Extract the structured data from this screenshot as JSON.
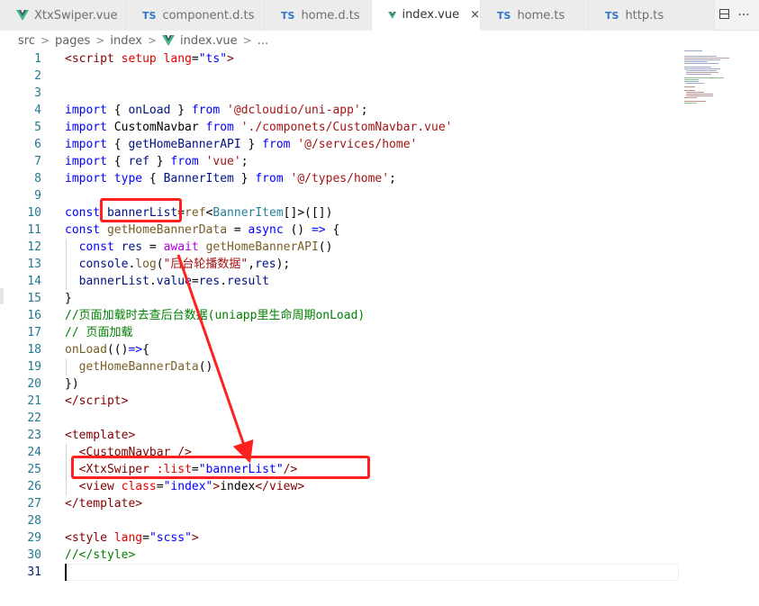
{
  "tabs": [
    {
      "label": "XtxSwiper.vue",
      "type": "vue",
      "active": false
    },
    {
      "label": "component.d.ts",
      "type": "ts",
      "active": false
    },
    {
      "label": "home.d.ts",
      "type": "ts",
      "active": false
    },
    {
      "label": "index.vue",
      "type": "vue",
      "active": true
    },
    {
      "label": "home.ts",
      "type": "ts",
      "active": false
    },
    {
      "label": "http.ts",
      "type": "ts",
      "active": false
    }
  ],
  "tab_icons": {
    "vue": "vue-icon",
    "ts": "TS",
    "close": "×"
  },
  "tab_actions": {
    "split": "split-editor-icon",
    "more": "···"
  },
  "breadcrumb": {
    "parts": [
      "src",
      "pages",
      "index",
      "index.vue",
      "..."
    ],
    "separator": ">"
  },
  "editor": {
    "line_numbers": [
      "1",
      "2",
      "3",
      "4",
      "5",
      "6",
      "7",
      "8",
      "9",
      "10",
      "11",
      "12",
      "13",
      "14",
      "15",
      "16",
      "17",
      "18",
      "19",
      "20",
      "21",
      "22",
      "23",
      "24",
      "25",
      "26",
      "27",
      "28",
      "29",
      "30",
      "31"
    ],
    "current_line": "31",
    "code": {
      "l1": [
        "<",
        "script",
        " ",
        "setup",
        " ",
        "lang",
        "=",
        "\"ts\"",
        ">"
      ],
      "l4": [
        "import",
        " { ",
        "onLoad",
        " } ",
        "from",
        " ",
        "'@dcloudio/uni-app'",
        ";"
      ],
      "l5": [
        "import",
        " CustomNavbar ",
        "from",
        " ",
        "'./componets/CustomNavbar.vue'"
      ],
      "l6": [
        "import",
        " { ",
        "getHomeBannerAPI",
        " } ",
        "from",
        " ",
        "'@/services/home'"
      ],
      "l7": [
        "import",
        " { ",
        "ref",
        " } ",
        "from",
        " ",
        "'vue'",
        ";"
      ],
      "l8": [
        "import",
        " ",
        "type",
        " { ",
        "BannerItem",
        " } ",
        "from",
        " ",
        "'@/types/home'",
        ";"
      ],
      "l10": [
        "const",
        " ",
        "bannerList",
        "=",
        "ref",
        "<",
        "BannerItem",
        "[]>([])"
      ],
      "l11": [
        "const",
        " ",
        "getHomeBannerData",
        " = ",
        "async",
        " () ",
        "=>",
        " {"
      ],
      "l12": [
        "  ",
        "const",
        " ",
        "res",
        " = ",
        "await",
        " ",
        "getHomeBannerAPI",
        "()"
      ],
      "l13": [
        "  ",
        "console",
        ".",
        "log",
        "(",
        "\"后台轮播数据\"",
        ",",
        "res",
        ");"
      ],
      "l14": [
        "  ",
        "bannerList",
        ".",
        "value",
        "=",
        "res",
        ".",
        "result"
      ],
      "l15": [
        "}"
      ],
      "l16": [
        "//页面加载时去查后台数据(uniapp里生命周期onLoad)"
      ],
      "l17": [
        "// 页面加载"
      ],
      "l18": [
        "onLoad",
        "(",
        "()",
        "=>",
        "{"
      ],
      "l19": [
        "  ",
        "getHomeBannerData",
        "()"
      ],
      "l20": [
        "})"
      ],
      "l21": [
        "</",
        "script",
        ">"
      ],
      "l23": [
        "<",
        "template",
        ">"
      ],
      "l24": [
        "  <",
        "CustomNavbar",
        " />"
      ],
      "l25": [
        "  <",
        "XtxSwiper",
        " ",
        ":list",
        "=",
        "\"bannerList\"",
        "/>"
      ],
      "l26": [
        "  <",
        "view",
        " ",
        "class",
        "=",
        "\"index\"",
        ">",
        "index",
        "</",
        "view",
        ">"
      ],
      "l27": [
        "</",
        "template",
        ">"
      ],
      "l29": [
        "<",
        "style",
        " ",
        "lang",
        "=",
        "\"scss\"",
        ">"
      ],
      "l30": [
        "//</",
        "style",
        ">"
      ]
    }
  },
  "annotation": {
    "color": "#ff2020"
  }
}
